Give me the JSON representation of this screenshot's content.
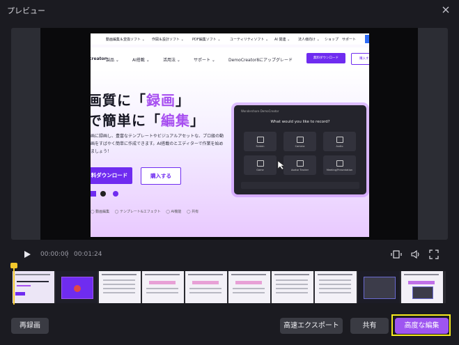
{
  "window": {
    "title": "プレビュー"
  },
  "site": {
    "topnav": [
      "動画編集＆変換ソフト ⌄",
      "作図＆設計ソフト ⌄",
      "PDF編集ソフト ⌄",
      "ユーティリティソフト ⌄",
      "AI 関連 ⌄",
      "法人様向け ⌄",
      "ショップ",
      "サポート"
    ],
    "nav": [
      "creator",
      "製品 ⌄",
      "AI搭載 ⌄",
      "活用法 ⌄",
      "サポート ⌄",
      "DemoCreator8にアップグレード"
    ],
    "nav_download": "無料ダウンロード",
    "nav_buy": "購入する",
    "headline1_pre": "画質に「",
    "headline1_accent": "録画",
    "headline1_post": "」",
    "headline2_pre": "で簡単に「",
    "headline2_accent": "編集",
    "headline2_post": "」",
    "desc": "画に録画し、豊富なテンプレートやビジュアルアセットな、プロ級の動画をすばやく簡単に作成できます。AI搭載のとエディターで作業を始めましょう！",
    "cta_download": "料ダウンロード",
    "cta_buy": "購入する",
    "features": [
      "◯ 動画編集",
      "◯ テンプレート&エフェクト",
      "◯ AI機能",
      "◯ 共有"
    ],
    "mock_title": "Wondershare DemoCreator",
    "mock_question": "What would you like to record?",
    "mock_tiles": [
      "Screen",
      "Camera",
      "Audio",
      "Game",
      "Avatar Tracker",
      "Meeting/Presentation"
    ]
  },
  "player": {
    "current_time": "00:00:00",
    "total_time": "00:01:24"
  },
  "colors": {
    "accent": "#9e55f1",
    "highlight": "#f6ea1d",
    "playhead": "#f2c82c"
  },
  "buttons": {
    "rerecord": "再録画",
    "fast_export": "高速エクスポート",
    "share": "共有",
    "advanced_edit": "高度な編集"
  }
}
